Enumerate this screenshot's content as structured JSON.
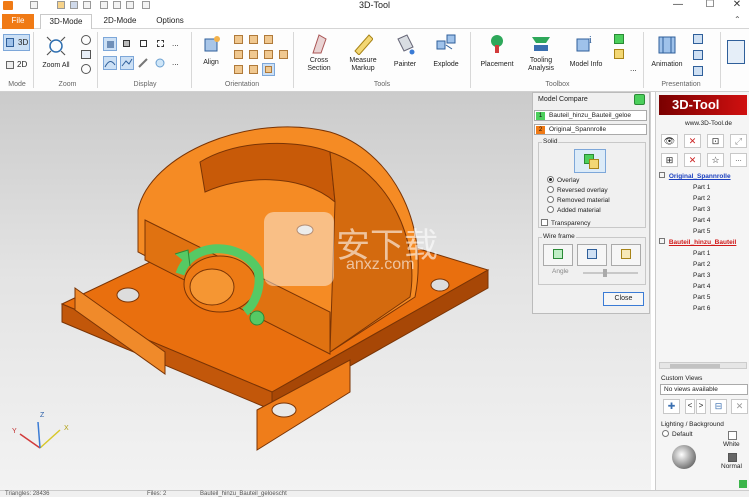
{
  "window": {
    "title": "3D-Tool",
    "minimize": "—",
    "maximize": "☐",
    "close": "✕"
  },
  "tabs": [
    "File",
    "3D-Mode",
    "2D-Mode",
    "Options"
  ],
  "ribbon": {
    "mode": {
      "btn3d": "3D",
      "btn2d": "2D",
      "label": "Mode"
    },
    "zoom": {
      "zoom_all": "Zoom All",
      "label": "Zoom"
    },
    "display": {
      "label": "Display",
      "more": "..."
    },
    "orientation": {
      "align": "Align",
      "label": "Orientation"
    },
    "tools": {
      "cross_section": "Cross\nSection",
      "measure": "Measure\nMarkup",
      "painter": "Painter",
      "explode": "Explode",
      "label": "Tools"
    },
    "toolbox": {
      "placement": "Placement",
      "tooling": "Tooling\nAnalysis",
      "model_info": "Model Info",
      "label": "Toolbox",
      "more": "..."
    },
    "presentation": {
      "animation": "Animation",
      "label": "Presentation"
    }
  },
  "model_compare": {
    "title": "Model Compare",
    "model1_num": "1",
    "model1": "Bauteil_hinzu_Bauteil_geloe",
    "model2_num": "2",
    "model2": "Original_Spannrolle",
    "solid_label": "Solid",
    "options": [
      "Overlay",
      "Reversed overlay",
      "Removed material",
      "Added material"
    ],
    "selected": "Overlay",
    "transparency": "Transparency",
    "wireframe_label": "Wire frame",
    "angle_label": "Angle",
    "close": "Close",
    "colors": {
      "model1": "#4ccf5c",
      "model2": "#f07a15"
    }
  },
  "right_panel": {
    "logo": "3D-Tool",
    "url": "www.3D-Tool.de",
    "tree": [
      {
        "name": "Original_Spannrolle",
        "color": "#1a3fc0",
        "parts": [
          "Part 1",
          "Part 2",
          "Part 3",
          "Part 4",
          "Part 5"
        ]
      },
      {
        "name": "Bauteil_hinzu_Bauteil",
        "color": "#d01818",
        "parts": [
          "Part 1",
          "Part 2",
          "Part 3",
          "Part 4",
          "Part 5",
          "Part 6"
        ]
      }
    ],
    "custom_views_label": "Custom Views",
    "custom_views_value": "No views available",
    "lighting_label": "Lighting / Background",
    "default_label": "Default",
    "white_label": "White",
    "normal_label": "Normal"
  },
  "status": {
    "left": "Triangles: 28436",
    "files": "Files: 2",
    "file": "Bauteil_hinzu_Bauteil_geloescht"
  },
  "watermark": {
    "cn": "安下载",
    "en": "anxz.com"
  },
  "axis": {
    "x": "X",
    "y": "Y",
    "z": "Z"
  },
  "accent": "#f07a15"
}
